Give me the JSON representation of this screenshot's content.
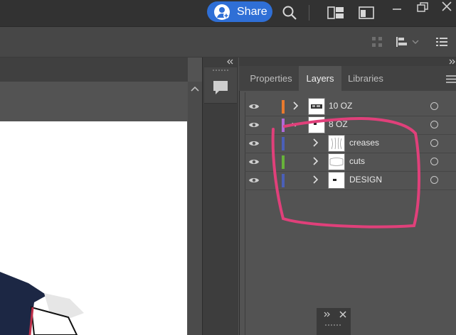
{
  "topbar": {
    "share_label": "Share",
    "icons": [
      "share-avatar-icon",
      "search-icon",
      "arrange-documents-icon",
      "workspace-icon",
      "minimize-icon",
      "restore-icon",
      "close-icon"
    ]
  },
  "controlbar": {
    "icons": [
      "align-grid-icon",
      "align-dropdown-icon",
      "properties-list-icon"
    ]
  },
  "panel": {
    "tabs": [
      {
        "label": "Properties"
      },
      {
        "label": "Layers"
      },
      {
        "label": "Libraries"
      }
    ],
    "active_tab": "Layers",
    "layers": [
      {
        "name": "10 OZ",
        "color": "#e87a2e",
        "expanded": false,
        "level": 0
      },
      {
        "name": "8 OZ",
        "color": "#b06ad6",
        "expanded": true,
        "level": 0
      },
      {
        "name": "creases",
        "color": "#4a5fb8",
        "expanded": false,
        "level": 1
      },
      {
        "name": "cuts",
        "color": "#67b33a",
        "expanded": false,
        "level": 1
      },
      {
        "name": "DESIGN",
        "color": "#4a5fb8",
        "expanded": false,
        "level": 1
      }
    ]
  },
  "colors": {
    "share_button": "#2f6fd6",
    "annotation": "#e0407a",
    "page": "#ffffff",
    "navy_shape": "#1c2744"
  }
}
